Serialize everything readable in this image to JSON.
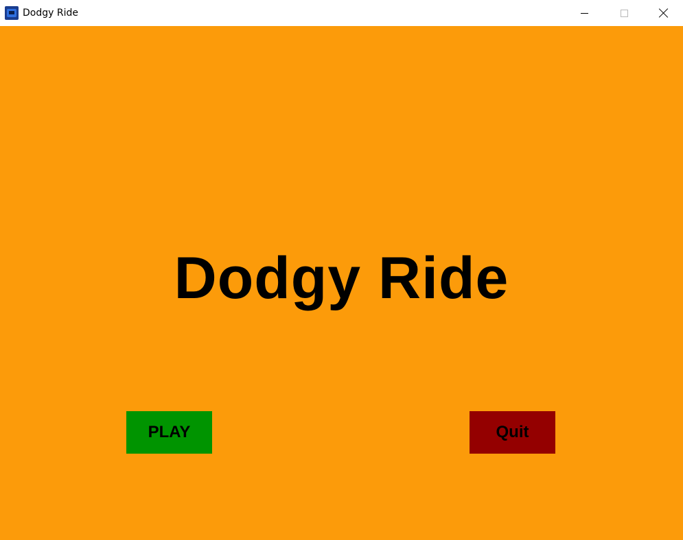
{
  "window": {
    "title": "Dodgy Ride",
    "icon": "car-app-icon"
  },
  "controls": {
    "minimize_icon": "minimize-icon",
    "maximize_icon": "maximize-icon",
    "close_icon": "close-icon"
  },
  "game": {
    "title": "Dodgy Ride",
    "background_color": "#fc9b0a",
    "play_button": {
      "label": "PLAY",
      "color": "#009400"
    },
    "quit_button": {
      "label": "Quit",
      "color": "#940000"
    }
  }
}
